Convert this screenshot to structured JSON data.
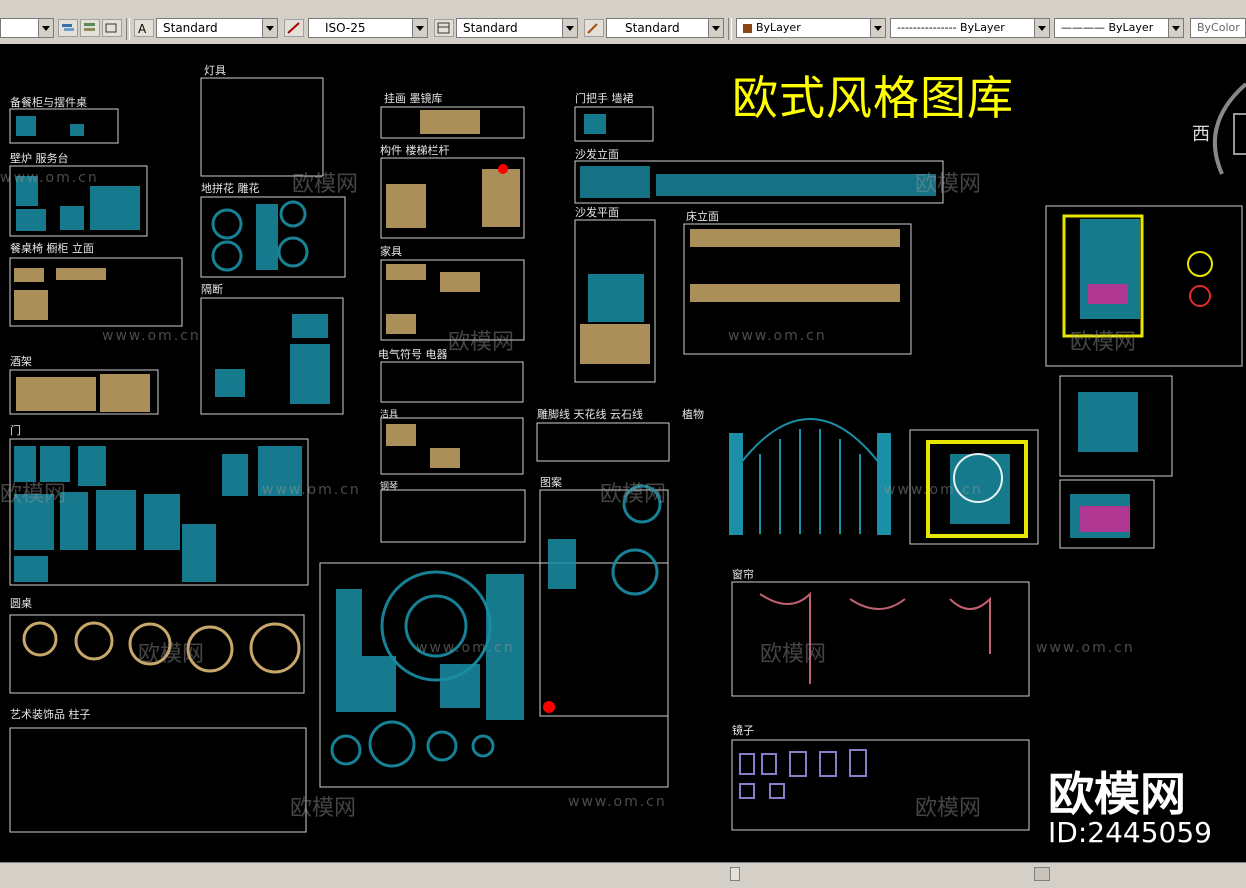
{
  "toolbar": {
    "text_style": "Standard",
    "dim_style": "ISO-25",
    "table_style": "Standard",
    "multileader_style": "Standard",
    "layer_color": "ByLayer",
    "linetype": "--------------- ByLayer",
    "lineweight": "———— ByLayer",
    "plot_style": "ByColor"
  },
  "drawing": {
    "main_title": "欧式风格图库",
    "compass_label": "西",
    "labels": [
      "备餐柜与摆件桌",
      "壁炉  服务台",
      "餐桌椅  橱柜  立面",
      "酒架",
      "门",
      "圆桌",
      "艺术装饰品  柱子",
      "灯具",
      "地拼花  雕花",
      "隔断",
      "挂画  墨镜库",
      "构件  楼梯栏杆",
      "家具",
      "电气符号  电器",
      "洁具",
      "钢琴",
      "门把手  墙裙",
      "沙发立面",
      "沙发平面",
      "雕脚线  天花线  云石线",
      "植物",
      "图案",
      "床立面",
      "窗帘",
      "镜子"
    ]
  },
  "watermark": {
    "brand": "欧模网",
    "id_text": "ID:2445059",
    "site": "www.om.cn",
    "small_brand": "欧模网"
  },
  "colors": {
    "title": "#ffff00",
    "block_cyan": "#1a8fa6",
    "block_tan": "#c8a86a",
    "frame": "#ffffff"
  }
}
